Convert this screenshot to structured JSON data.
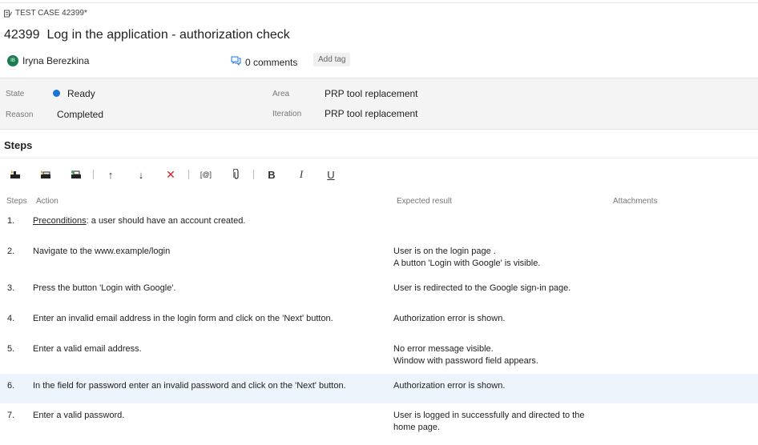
{
  "header": {
    "type_label": "TEST CASE 42399*",
    "id": "42399",
    "title": "Log in the application - authorization check",
    "author_initial": "IB",
    "author": "Iryna Berezkina",
    "comments": "0 comments",
    "add_tag": "Add tag"
  },
  "fields": {
    "state_label": "State",
    "state_value": "Ready",
    "state_color": "#1a74d4",
    "reason_label": "Reason",
    "reason_value": "Completed",
    "area_label": "Area",
    "area_value": "PRP tool replacement",
    "iteration_label": "Iteration",
    "iteration_value": "PRP tool replacement"
  },
  "steps_section": {
    "title": "Steps",
    "toolbar": {
      "bold": "B",
      "italic": "I",
      "underline": "U"
    },
    "columns": {
      "steps": "Steps",
      "action": "Action",
      "expected": "Expected result",
      "attachments": "Attachments"
    },
    "rows": [
      {
        "num": "1.",
        "action_link": "Preconditions",
        "action": ": a user should have an account created.",
        "expected1": "",
        "expected2": ""
      },
      {
        "num": "2.",
        "action_link": "",
        "action": "Navigate to the www.example/login",
        "expected1": "User is on the login page .",
        "expected2": "A button 'Login with Google' is visible."
      },
      {
        "num": "3.",
        "action_link": "",
        "action": "Press the button 'Login with Google'.",
        "expected1": "User is redirected to the Google sign-in page.",
        "expected2": ""
      },
      {
        "num": "4.",
        "action_link": "",
        "action": "Enter an invalid email address in the login form and click on the 'Next' button.",
        "expected1": "Authorization error is shown.",
        "expected2": ""
      },
      {
        "num": "5.",
        "action_link": "",
        "action": "Enter a valid email address.",
        "expected1": "No error message visible.",
        "expected2": "Window with password field appears."
      },
      {
        "num": "6.",
        "action_link": "",
        "action": "In the field for password enter an invalid password and click on the 'Next' button.",
        "expected1": "Authorization error is shown.",
        "expected2": ""
      },
      {
        "num": "7.",
        "action_link": "",
        "action": "Enter a valid password.",
        "expected1": "User is logged in successfully and directed to the",
        "expected2": "home page."
      }
    ]
  }
}
